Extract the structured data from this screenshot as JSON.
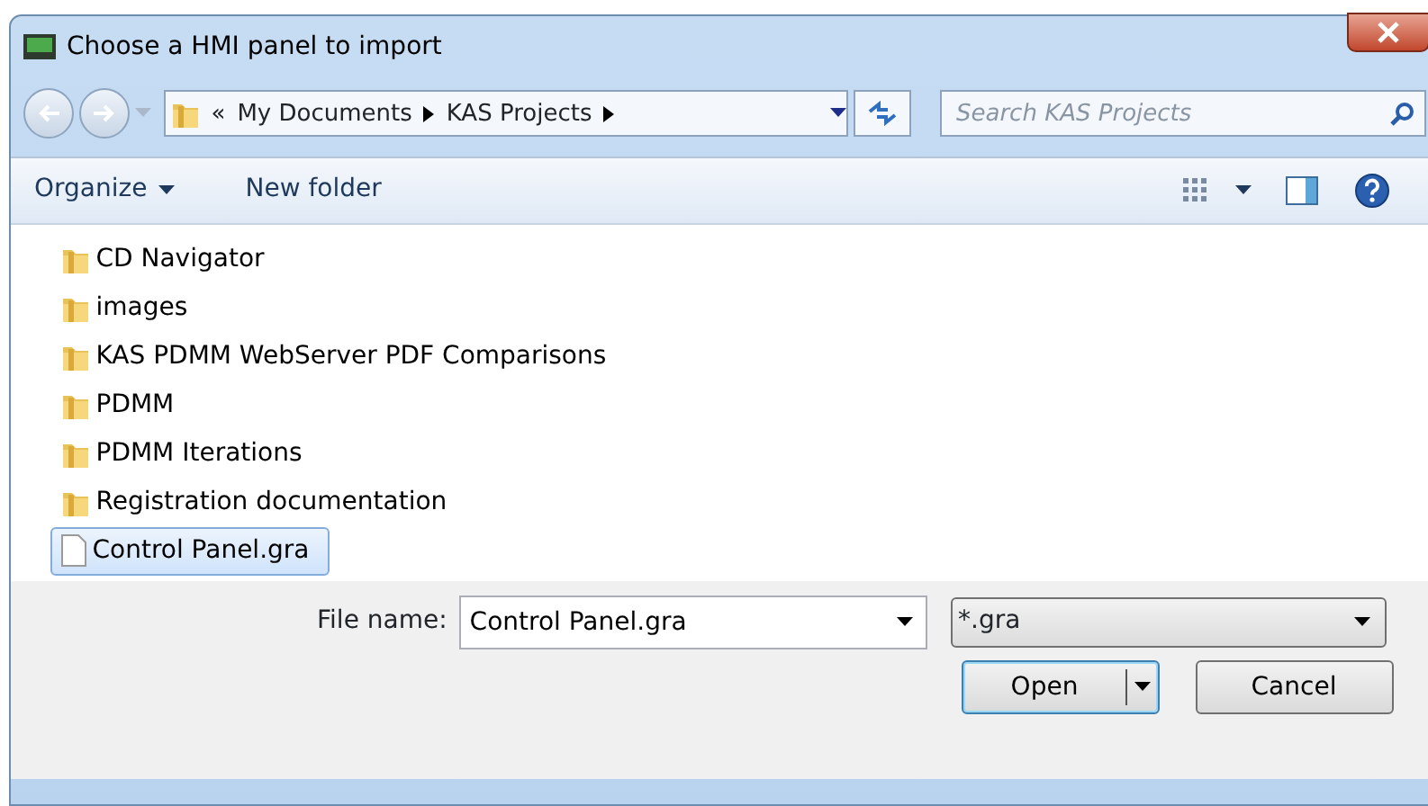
{
  "window": {
    "title": "Choose a HMI panel to import"
  },
  "address": {
    "overflow": "«",
    "crumbs": [
      "My Documents",
      "KAS Projects"
    ]
  },
  "search": {
    "placeholder": "Search KAS Projects"
  },
  "toolbar": {
    "organize": "Organize",
    "new_folder": "New folder"
  },
  "files": [
    {
      "name": "CD Navigator",
      "kind": "folder",
      "selected": false
    },
    {
      "name": "images",
      "kind": "folder",
      "selected": false
    },
    {
      "name": "KAS PDMM WebServer PDF Comparisons",
      "kind": "folder",
      "selected": false
    },
    {
      "name": "PDMM",
      "kind": "folder",
      "selected": false
    },
    {
      "name": "PDMM Iterations",
      "kind": "folder",
      "selected": false
    },
    {
      "name": "Registration documentation",
      "kind": "folder",
      "selected": false
    },
    {
      "name": "Control Panel.gra",
      "kind": "file",
      "selected": true
    }
  ],
  "file_name": {
    "label": "File name:",
    "value": "Control Panel.gra"
  },
  "file_type": {
    "value": "*.gra"
  },
  "buttons": {
    "open": "Open",
    "cancel": "Cancel"
  }
}
